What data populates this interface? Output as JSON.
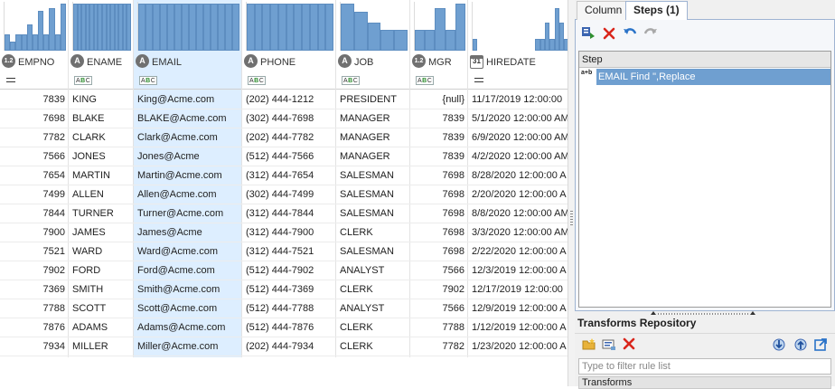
{
  "columns": [
    {
      "name": "EMPNO",
      "type_icon": "numeric-icon",
      "type_glyph": "1.2",
      "filter": "equals"
    },
    {
      "name": "ENAME",
      "type_icon": "text-icon",
      "type_glyph": "A",
      "filter": "abc"
    },
    {
      "name": "EMAIL",
      "type_icon": "text-icon",
      "type_glyph": "A",
      "filter": "abc"
    },
    {
      "name": "PHONE",
      "type_icon": "text-icon",
      "type_glyph": "A",
      "filter": "abc"
    },
    {
      "name": "JOB",
      "type_icon": "text-icon",
      "type_glyph": "A",
      "filter": "abc"
    },
    {
      "name": "MGR",
      "type_icon": "numeric-icon",
      "type_glyph": "1.2",
      "filter": "abc"
    },
    {
      "name": "HIREDATE",
      "type_icon": "calendar-icon",
      "type_glyph": "31",
      "filter": "equals"
    }
  ],
  "abc_label": {
    "a": "A",
    "b": "B",
    "c": "C"
  },
  "rows": [
    [
      "7839",
      "KING",
      "King@Acme.com",
      "(202) 444-1212",
      "PRESIDENT",
      "{null}",
      "11/17/2019 12:00:00"
    ],
    [
      "7698",
      "BLAKE",
      "BLAKE@Acme.com",
      "(302) 444-7698",
      "MANAGER",
      "7839",
      "5/1/2020 12:00:00 AM"
    ],
    [
      "7782",
      "CLARK",
      "Clark@Acme.com",
      "(202) 444-7782",
      "MANAGER",
      "7839",
      "6/9/2020 12:00:00 AM"
    ],
    [
      "7566",
      "JONES",
      "Jones@Acme",
      "(512) 444-7566",
      "MANAGER",
      "7839",
      "4/2/2020 12:00:00 AM"
    ],
    [
      "7654",
      "MARTIN",
      "Martin@Acme.com",
      "(312) 444-7654",
      "SALESMAN",
      "7698",
      "8/28/2020 12:00:00 A"
    ],
    [
      "7499",
      "ALLEN",
      "Allen@Acme.com",
      "(302) 444-7499",
      "SALESMAN",
      "7698",
      "2/20/2020 12:00:00 A"
    ],
    [
      "7844",
      "TURNER",
      "Turner@Acme.com",
      "(312) 444-7844",
      "SALESMAN",
      "7698",
      "8/8/2020 12:00:00 AM"
    ],
    [
      "7900",
      "JAMES",
      "James@Acme",
      "(312) 444-7900",
      "CLERK",
      "7698",
      "3/3/2020 12:00:00 AM"
    ],
    [
      "7521",
      "WARD",
      "Ward@Acme.com",
      "(312) 444-7521",
      "SALESMAN",
      "7698",
      "2/22/2020 12:00:00 A"
    ],
    [
      "7902",
      "FORD",
      "Ford@Acme.com",
      "(512) 444-7902",
      "ANALYST",
      "7566",
      "12/3/2019 12:00:00 A"
    ],
    [
      "7369",
      "SMITH",
      "Smith@Acme.com",
      "(512) 444-7369",
      "CLERK",
      "7902",
      "12/17/2019 12:00:00"
    ],
    [
      "7788",
      "SCOTT",
      "Scott@Acme.com",
      "(512) 444-7788",
      "ANALYST",
      "7566",
      "12/9/2019 12:00:00 A"
    ],
    [
      "7876",
      "ADAMS",
      "Adams@Acme.com",
      "(512) 444-7876",
      "CLERK",
      "7788",
      "1/12/2019 12:00:00 A"
    ],
    [
      "7934",
      "MILLER",
      "Miller@Acme.com",
      "(202) 444-7934",
      "CLERK",
      "7782",
      "1/23/2020 12:00:00 A"
    ]
  ],
  "histograms": {
    "EMPNO": [
      0.35,
      0.2,
      0.35,
      0.35,
      0.55,
      0.35,
      0.85,
      0.35,
      0.9,
      0.35,
      1.0
    ],
    "ENAME": [
      1,
      1,
      1,
      1,
      1,
      1,
      1,
      1,
      1,
      1,
      1,
      1,
      1,
      1
    ],
    "EMAIL": [
      1,
      1,
      1,
      1,
      1,
      1,
      1,
      1,
      1,
      1,
      1,
      1,
      1,
      1
    ],
    "PHONE": [
      1,
      1,
      1,
      1,
      1,
      1,
      1,
      1,
      1,
      1,
      1
    ],
    "JOB": [
      1.0,
      0.82,
      0.6,
      0.45,
      0.45
    ],
    "MGR": [
      0.45,
      0.45,
      0.9,
      0.45,
      1.0
    ],
    "HIREDATE": [
      0.25,
      0,
      0,
      0,
      0,
      0,
      0,
      0,
      0,
      0,
      0,
      0,
      0,
      0.25,
      0.25,
      0.6,
      0.25,
      0.9,
      0.6,
      0.25,
      1.0
    ]
  },
  "selected_column": "EMAIL",
  "panel": {
    "tabs": [
      {
        "label": "Column"
      },
      {
        "label": "Steps (1)"
      }
    ],
    "active_tab": "Steps (1)",
    "step_toolbar": [
      "apply-steps-icon",
      "delete-icon",
      "undo-icon",
      "redo-icon"
    ],
    "step_header": "Step",
    "steps": [
      {
        "index_glyph": "a+b",
        "label": "EMAIL Find \",Replace"
      }
    ],
    "repository_title": "Transforms Repository",
    "repository_toolbar": [
      "open-folder-icon",
      "edit-icon",
      "delete-icon",
      "import-icon",
      "export-icon",
      "open-external-icon"
    ],
    "filter_placeholder": "Type to filter rule list",
    "group_label": "Transforms"
  },
  "colors": {
    "accent": "#6f9fd0",
    "selected_column_bg": "#ddeeff",
    "delete": "#d9261c"
  }
}
